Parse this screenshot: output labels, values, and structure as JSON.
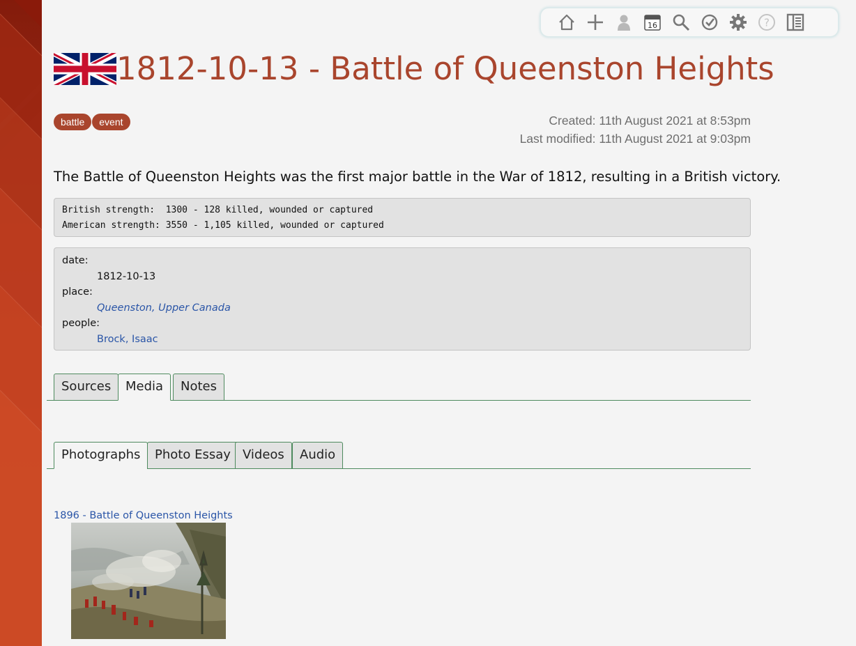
{
  "toolbar": {
    "buttons": [
      {
        "icon": "home-icon"
      },
      {
        "icon": "plus-icon"
      },
      {
        "icon": "user-icon"
      },
      {
        "icon": "calendar-icon",
        "label": "16"
      },
      {
        "icon": "search-icon"
      },
      {
        "icon": "check-circle-icon"
      },
      {
        "icon": "gear-icon"
      },
      {
        "icon": "help-icon",
        "label": "?"
      },
      {
        "icon": "sidebar-toggle-icon"
      }
    ]
  },
  "page": {
    "title": "1812-10-13 - Battle of Queenston Heights",
    "flag_icon": "union-jack-flag-icon",
    "tags": [
      "battle",
      "event"
    ],
    "created": "Created: 11th August 2021 at 8:53pm",
    "modified": "Last modified: 11th August 2021 at 9:03pm",
    "summary": "The Battle of Queenston Heights was the first major battle in the War of 1812, resulting in a British victory.",
    "strength_lines": [
      "British strength:  1300 - 128 killed, wounded or captured",
      "American strength: 3550 - 1,105 killed, wounded or captured"
    ],
    "fields": {
      "date_label": "date:",
      "date_value": "1812-10-13",
      "place_label": "place:",
      "place_value": "Queenston, Upper Canada",
      "people_label": "people:",
      "people_value": "Brock, Isaac"
    }
  },
  "tabs_main": [
    {
      "label": "Sources",
      "active": false
    },
    {
      "label": "Media",
      "active": true
    },
    {
      "label": "Notes",
      "active": false
    }
  ],
  "tabs_media": [
    {
      "label": "Photographs",
      "active": true
    },
    {
      "label": "Photo Essay",
      "active": false
    },
    {
      "label": "Videos",
      "active": false
    },
    {
      "label": "Audio",
      "active": false
    }
  ],
  "media": {
    "photo_title": "1896 - Battle of Queenston Heights",
    "photo_icon": "battle-painting-thumbnail"
  },
  "colors": {
    "accent": "#a9452d",
    "link": "#2a55a7",
    "tab_border": "#4e8a5e"
  }
}
